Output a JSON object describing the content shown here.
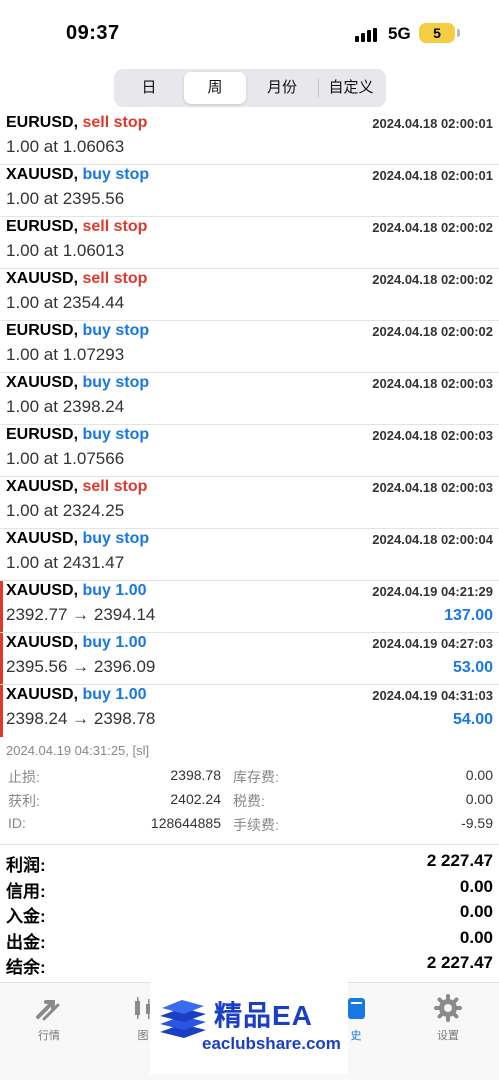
{
  "status_bar": {
    "time": "09:37",
    "network": "5G",
    "battery": "5"
  },
  "period_tabs": [
    {
      "label": "日",
      "active": false
    },
    {
      "label": "周",
      "active": true
    },
    {
      "label": "月份",
      "active": false
    },
    {
      "label": "自定义",
      "active": false
    }
  ],
  "orders": [
    {
      "symbol": "EURUSD,",
      "action": "sell stop",
      "action_color": "#e0392b",
      "datetime": "2024.04.18 02:00:01",
      "detail": "1.00 at 1.06063"
    },
    {
      "symbol": "XAUUSD,",
      "action": "buy stop",
      "action_color": "#1778e6",
      "datetime": "2024.04.18 02:00:01",
      "detail": "1.00 at 2395.56"
    },
    {
      "symbol": "EURUSD,",
      "action": "sell stop",
      "action_color": "#e0392b",
      "datetime": "2024.04.18 02:00:02",
      "detail": "1.00 at 1.06013"
    },
    {
      "symbol": "XAUUSD,",
      "action": "sell stop",
      "action_color": "#e0392b",
      "datetime": "2024.04.18 02:00:02",
      "detail": "1.00 at 2354.44"
    },
    {
      "symbol": "EURUSD,",
      "action": "buy stop",
      "action_color": "#1778e6",
      "datetime": "2024.04.18 02:00:02",
      "detail": "1.00 at 1.07293"
    },
    {
      "symbol": "XAUUSD,",
      "action": "buy stop",
      "action_color": "#1778e6",
      "datetime": "2024.04.18 02:00:03",
      "detail": "1.00 at 2398.24"
    },
    {
      "symbol": "EURUSD,",
      "action": "buy stop",
      "action_color": "#1778e6",
      "datetime": "2024.04.18 02:00:03",
      "detail": "1.00 at 1.07566"
    },
    {
      "symbol": "XAUUSD,",
      "action": "sell stop",
      "action_color": "#e0392b",
      "datetime": "2024.04.18 02:00:03",
      "detail": "1.00 at 2324.25"
    },
    {
      "symbol": "XAUUSD,",
      "action": "buy stop",
      "action_color": "#1778e6",
      "datetime": "2024.04.18 02:00:04",
      "detail": "1.00 at 2431.47"
    }
  ],
  "deals": [
    {
      "symbol": "XAUUSD,",
      "action": "buy 1.00",
      "datetime": "2024.04.19 04:21:29",
      "prices": "2392.77 → 2394.14",
      "profit": "137.00"
    },
    {
      "symbol": "XAUUSD,",
      "action": "buy 1.00",
      "datetime": "2024.04.19 04:27:03",
      "prices": "2395.56 → 2396.09",
      "profit": "53.00"
    },
    {
      "symbol": "XAUUSD,",
      "action": "buy 1.00",
      "datetime": "2024.04.19 04:31:03",
      "prices": "2398.24 → 2398.78",
      "profit": "54.00"
    }
  ],
  "deal_detail": {
    "comment": "2024.04.19 04:31:25, [sl]",
    "stop_loss_label": "止损:",
    "stop_loss": "2398.78",
    "take_profit_label": "获利:",
    "take_profit": "2402.24",
    "id_label": "ID:",
    "id": "128644885",
    "swap_label": "库存费:",
    "swap": "0.00",
    "tax_label": "税费:",
    "tax": "0.00",
    "commission_label": "手续费:",
    "commission": "-9.59"
  },
  "summary": [
    {
      "label": "利润:",
      "value": "2 227.47"
    },
    {
      "label": "信用:",
      "value": "0.00"
    },
    {
      "label": "入金:",
      "value": "0.00"
    },
    {
      "label": "出金:",
      "value": "0.00"
    },
    {
      "label": "结余:",
      "value": "2 227.47"
    }
  ],
  "tab_bar": {
    "quotes": "行情",
    "chart": "图",
    "history": "史",
    "settings": "设置"
  },
  "watermark": {
    "title": "精品EA",
    "url": "eaclubshare.com"
  },
  "colors": {
    "sell": "#e0392b",
    "buy": "#1778e6",
    "accent": "#1778e6"
  }
}
